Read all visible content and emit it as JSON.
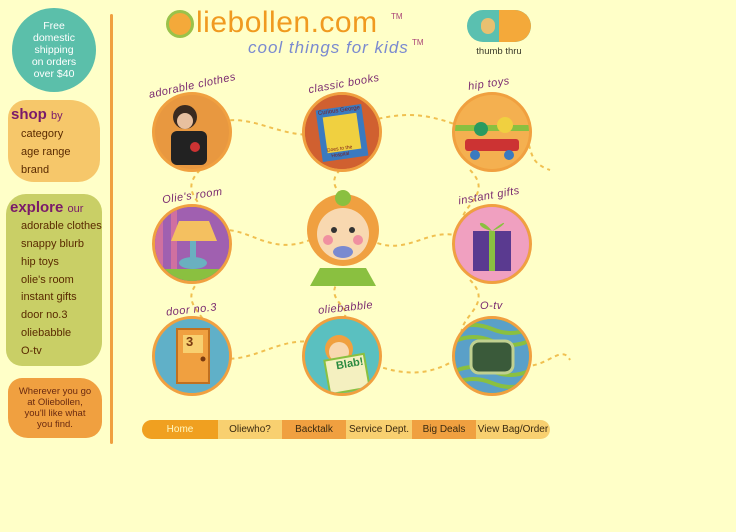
{
  "sidebar": {
    "shipping": [
      "Free",
      "domestic",
      "shipping",
      "on orders",
      "over $40"
    ],
    "shop_title": "shop",
    "shop_by": "by",
    "shop_links": [
      "category",
      "age range",
      "brand"
    ],
    "explore_title": "explore",
    "explore_our": "our",
    "explore_links": [
      "adorable clothes",
      "snappy blurb",
      "hip toys",
      "olie's room",
      "instant gifts",
      "door no.3",
      "oliebabble",
      "O-tv"
    ],
    "quote": [
      "Wherever you go",
      "at Oliebollen,",
      "you'll like what",
      "you find."
    ]
  },
  "header": {
    "logo": "liebollen.com",
    "tm": "TM",
    "tagline": "cool things for kids",
    "thumb_label": "thumb thru"
  },
  "circles": [
    {
      "caption": "adorable clothes"
    },
    {
      "caption": "classic books"
    },
    {
      "caption": "hip toys"
    },
    {
      "caption": "Olie's room"
    },
    {
      "caption": "instant gifts"
    },
    {
      "caption": "door no.3"
    },
    {
      "caption": "oliebabble"
    },
    {
      "caption": "O-tv"
    }
  ],
  "book_text": [
    "Curious George",
    "Goes to the Hospital"
  ],
  "door_number": "3",
  "blab": "Blab!",
  "nav": [
    "Home",
    "Oliewho?",
    "Backtalk",
    "Service Dept.",
    "Big Deals",
    "View Bag/Order"
  ],
  "colors": {
    "background": "#ffffc8",
    "orange": "#f0a040",
    "teal": "#5bbfaa",
    "olive": "#c9cf66",
    "purple": "#7a1a6a"
  }
}
